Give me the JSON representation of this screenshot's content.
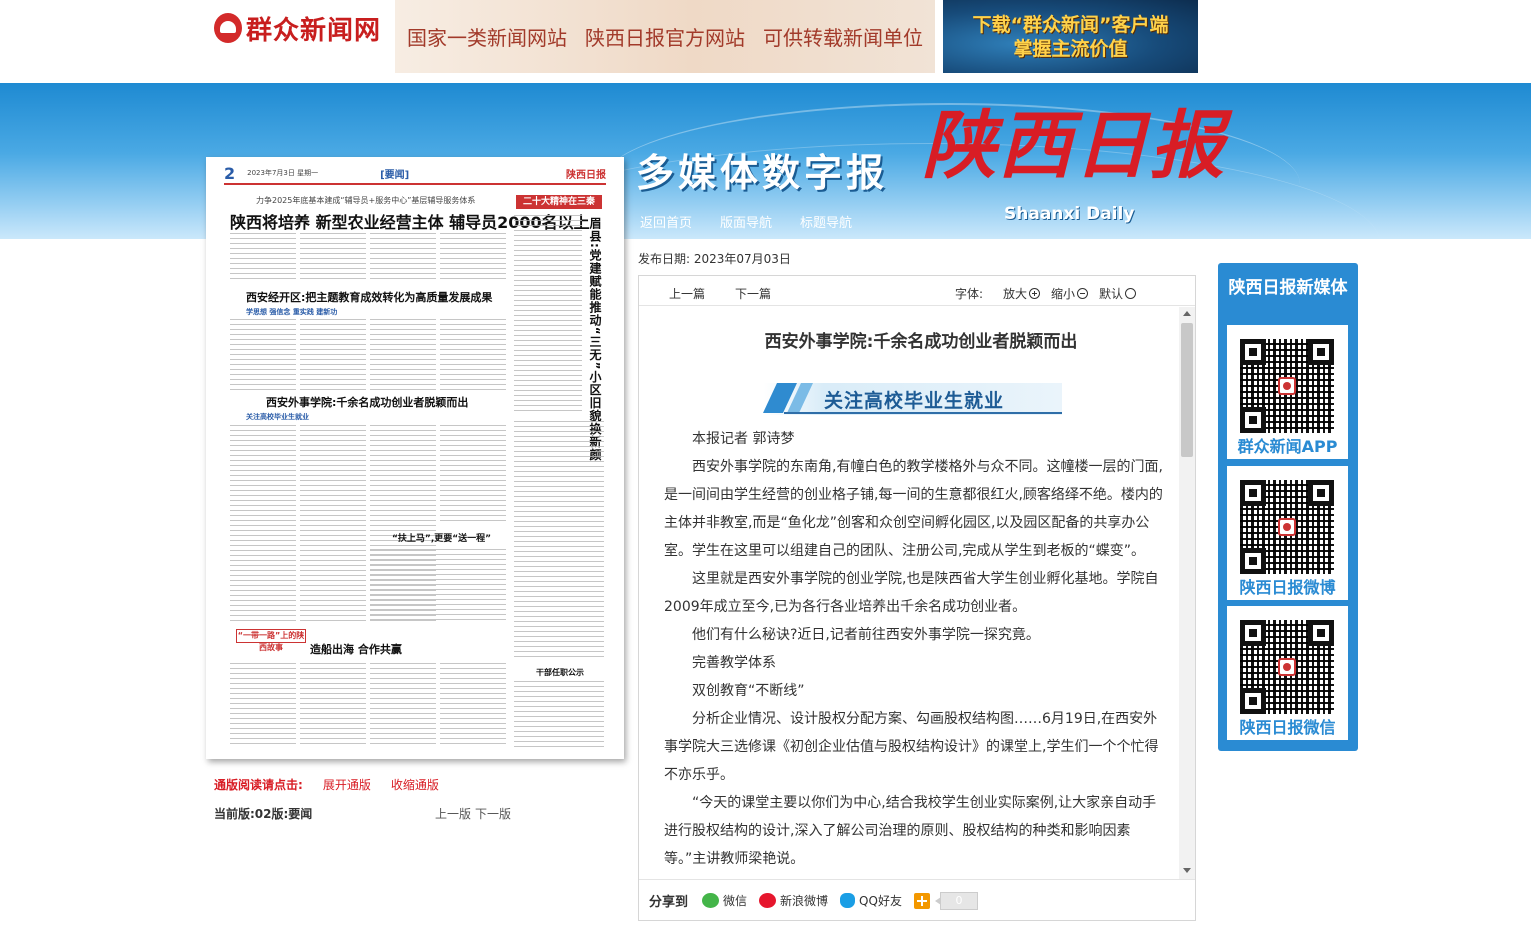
{
  "site": {
    "logo_text": "群众新闻网",
    "slogan": [
      "国家一类新闻网站",
      "陕西日报官方网站",
      "可供转载新闻单位"
    ],
    "app_banner": [
      "下载“群众新闻”客户端",
      "掌握主流价值"
    ]
  },
  "header": {
    "digital_title": "多媒体数字报",
    "paper_name": "陕西日报",
    "paper_name_en": "Shaanxi Daily",
    "nav": [
      "返回首页",
      "版面导航",
      "标题导航"
    ]
  },
  "page_thumb": {
    "page_no": "2",
    "date_line": "2023年7月3日  星期一",
    "section": "[要闻]",
    "brand": "陕西日报",
    "kicker": "力争2025年底基本建成“辅导员+服务中心”基层辅导服务体系",
    "headline1": "陕西将培养  新型农业经营主体  辅导员2000名以上",
    "headline2": "西安经开区:把主题教育成效转化为高质量发展成果",
    "headline3": "西安外事学院:千余名成功创业者脱颖而出",
    "subhead2": "学思想 强信念 重实践 建新功",
    "subhead3": "关注高校毕业生就业",
    "red_box": "二十大精神在三秦",
    "vertical": "眉县:党建赋能推动“三无”小区旧貌换新颜",
    "headline4": "造船出海  合作共赢",
    "headline5": "“扶上马”,更要“送一程”",
    "red_box2": "“一带一路”上的陕西故事",
    "notice": "干部任职公示"
  },
  "reading": {
    "tip_label": "通版阅读请点击:",
    "expand": "展开通版",
    "collapse": "收缩通版",
    "current": "当前版:02版:要闻",
    "prev_page": "上一版",
    "next_page": "下一版"
  },
  "article": {
    "pub_date": "发布日期: 2023年07月03日",
    "prev": "上一篇",
    "next": "下一篇",
    "font_label": "字体:",
    "zoom_in": "放大",
    "zoom_out": "缩小",
    "zoom_reset": "默认",
    "title": "西安外事学院:千余名成功创业者脱颖而出",
    "banner": "关注高校毕业生就业",
    "paragraphs": [
      "本报记者 郭诗梦",
      "西安外事学院的东南角,有幢白色的教学楼格外与众不同。这幢楼一层的门面,是一间间由学生经营的创业格子铺,每一间的生意都很红火,顾客络绎不绝。楼内的主体并非教室,而是“鱼化龙”创客和众创空间孵化园区,以及园区配备的共享办公室。学生在这里可以组建自己的团队、注册公司,完成从学生到老板的“蝶变”。",
      "这里就是西安外事学院的创业学院,也是陕西省大学生创业孵化基地。学院自2009年成立至今,已为各行各业培养出千余名成功创业者。",
      "他们有什么秘诀?近日,记者前往西安外事学院一探究竟。",
      "完善教学体系",
      "双创教育“不断线”",
      "分析企业情况、设计股权分配方案、勾画股权结构图……6月19日,在西安外事学院大三选修课《初创企业估值与股权结构设计》的课堂上,学生们一个个忙得不亦乐乎。",
      "“今天的课堂主要以你们为中心,结合我校学生创业实际案例,让大家亲自动手进行股权结构的设计,深入了解公司治理的原则、股权结构的种类和影响因素等。”主讲教师梁艳说。"
    ]
  },
  "share": {
    "label": "分享到",
    "wechat": "微信",
    "weibo": "新浪微博",
    "qq": "QQ好友",
    "count": "0"
  },
  "sidebar": {
    "title": "陕西日报新媒体",
    "cards": [
      "群众新闻APP",
      "陕西日报微博",
      "陕西日报微信"
    ]
  }
}
